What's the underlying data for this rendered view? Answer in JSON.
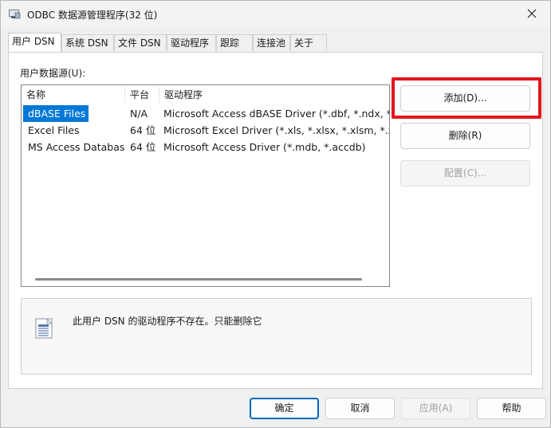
{
  "window": {
    "title": "ODBC 数据源管理程序(32 位)"
  },
  "tabs": [
    {
      "label": "用户 DSN",
      "active": true
    },
    {
      "label": "系统 DSN"
    },
    {
      "label": "文件 DSN"
    },
    {
      "label": "驱动程序"
    },
    {
      "label": "跟踪"
    },
    {
      "label": "连接池"
    },
    {
      "label": "关于"
    }
  ],
  "panel": {
    "group_label": "用户数据源(U):",
    "columns": [
      "名称",
      "平台",
      "驱动程序"
    ],
    "rows": [
      {
        "name": "dBASE Files",
        "platform": "N/A",
        "driver": "Microsoft Access dBASE Driver (*.dbf, *.ndx, *.mdx)",
        "selected": true
      },
      {
        "name": "Excel Files",
        "platform": "64 位",
        "driver": "Microsoft Excel Driver (*.xls, *.xlsx, *.xlsm, *.xlsb)"
      },
      {
        "name": "MS Access Database",
        "platform": "64 位",
        "driver": "Microsoft Access Driver (*.mdb, *.accdb)"
      }
    ],
    "buttons": {
      "add": "添加(D)...",
      "remove": "删除(R)",
      "configure": "配置(C)..."
    },
    "info_text": "此用户 DSN 的驱动程序不存在。只能删除它"
  },
  "footer": {
    "ok": "确定",
    "cancel": "取消",
    "apply": "应用(A)",
    "help": "帮助"
  },
  "colors": {
    "selection": "#0078d7",
    "highlight": "#e3161d",
    "default_button": "#0067c0"
  }
}
